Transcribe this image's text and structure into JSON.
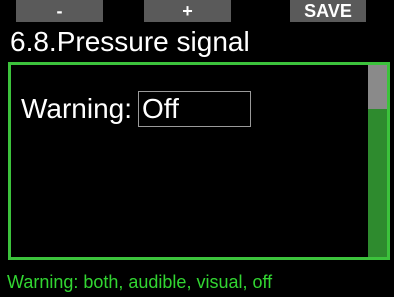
{
  "softkeys": {
    "left_label": "-",
    "middle_label": "+",
    "right_label": "SAVE"
  },
  "header": {
    "title": "6.8.Pressure signal"
  },
  "setting": {
    "label": "Warning:",
    "value": "Off"
  },
  "help": {
    "text": "Warning: both, audible, visual, off"
  },
  "colors": {
    "accent_green": "#3cc23c",
    "scroll_track": "#2e8b2e",
    "softkey_bg": "#5a5a5a",
    "background": "#000000"
  }
}
